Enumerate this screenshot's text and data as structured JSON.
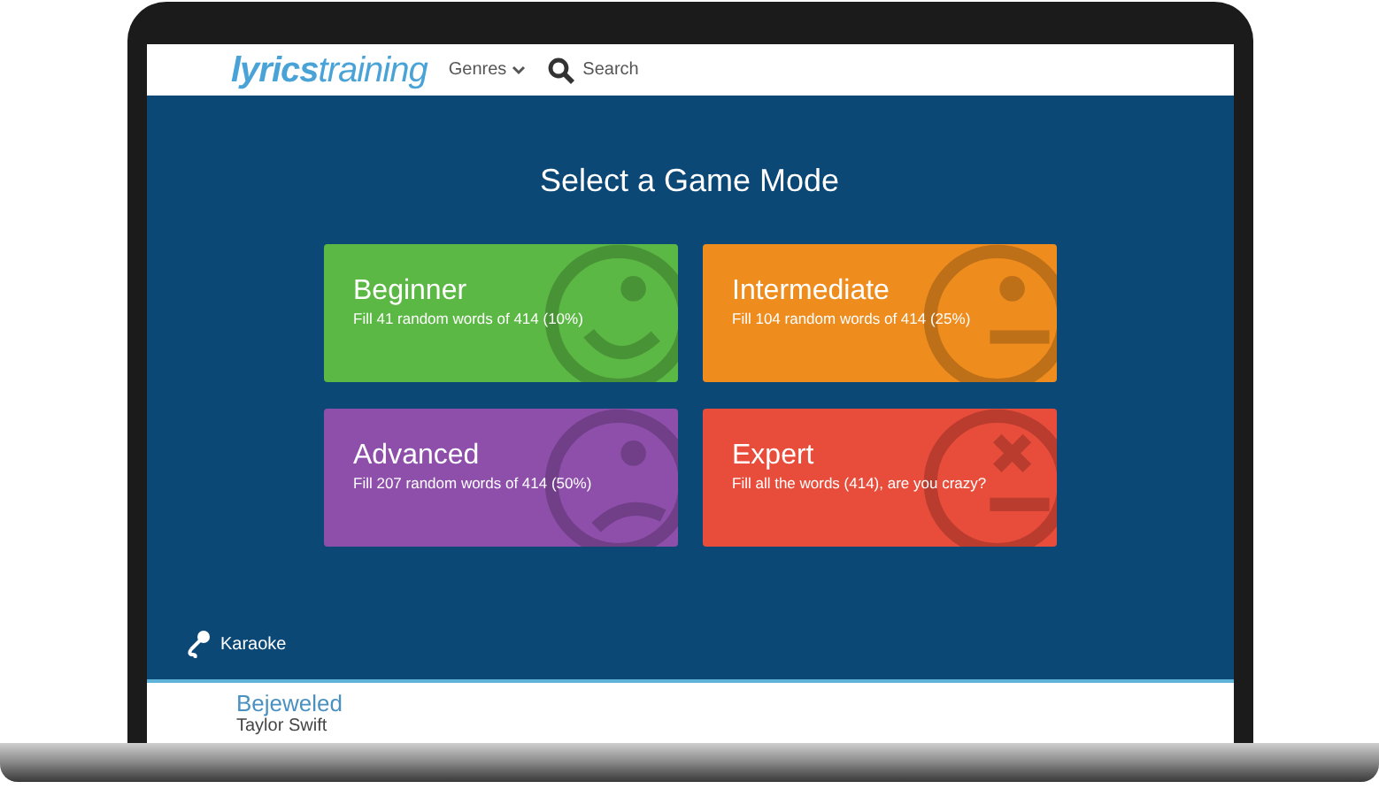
{
  "header": {
    "logo_left": "lyrics",
    "logo_right": "training",
    "genres": "Genres",
    "search": "Search"
  },
  "title": "Select a Game Mode",
  "modes": [
    {
      "name": "Beginner",
      "description": "Fill 41 random words of 414 (10%)",
      "color": "#5cb845",
      "kind": "smile"
    },
    {
      "name": "Intermediate",
      "description": "Fill 104 random words of 414 (25%)",
      "color": "#ee8c1e",
      "kind": "neutral"
    },
    {
      "name": "Advanced",
      "description": "Fill 207 random words of 414 (50%)",
      "color": "#8e4fab",
      "kind": "sad"
    },
    {
      "name": "Expert",
      "description": "Fill all the words (414), are you crazy?",
      "color": "#e84c3a",
      "kind": "dead"
    }
  ],
  "karaoke": "Karaoke",
  "song": {
    "title": "Bejeweled",
    "artist": "Taylor Swift"
  }
}
